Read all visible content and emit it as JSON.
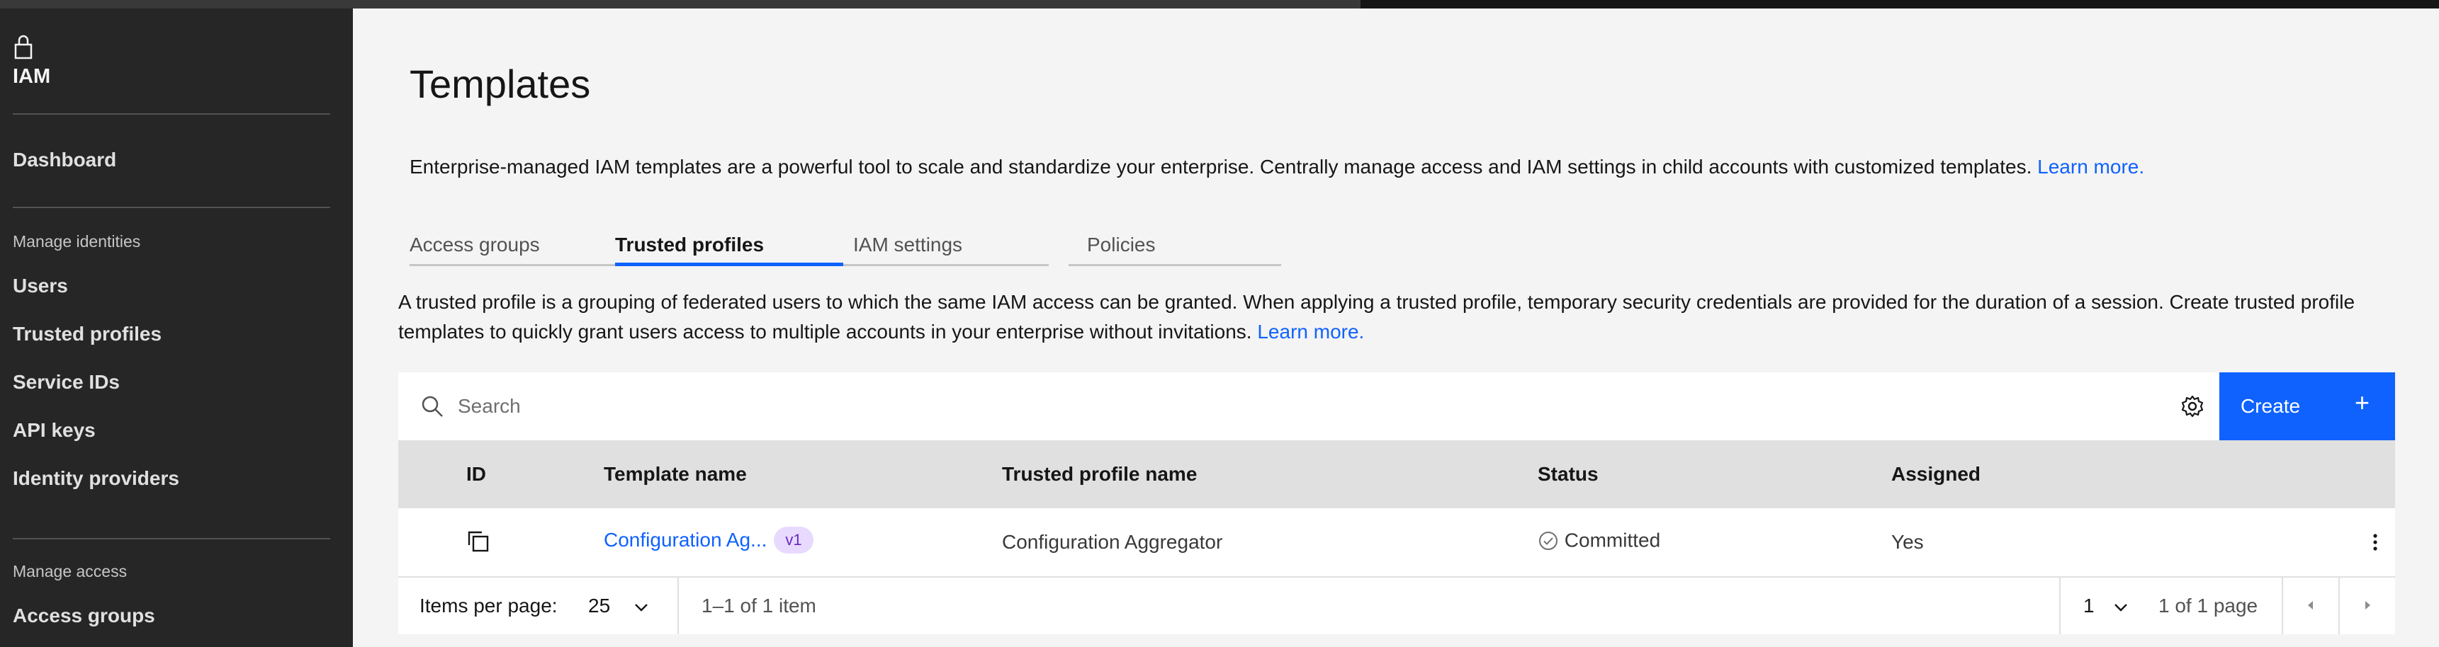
{
  "sidebar": {
    "brand": "IAM",
    "dashboard": "Dashboard",
    "sections": {
      "identities": "Manage identities",
      "access": "Manage access"
    },
    "identities_items": [
      "Users",
      "Trusted profiles",
      "Service IDs",
      "API keys",
      "Identity providers"
    ],
    "access_items": [
      "Access groups"
    ]
  },
  "main": {
    "title": "Templates",
    "intro": "Enterprise-managed IAM templates are a powerful tool to scale and standardize your enterprise. Centrally manage access and IAM settings in child accounts with customized templates.",
    "intro_link": "Learn more.",
    "tabs": [
      "Access groups",
      "Trusted profiles",
      "IAM settings",
      "Policies"
    ],
    "active_tab": "Trusted profiles",
    "tab_desc": "A trusted profile is a grouping of federated users to which the same IAM access can be granted. When applying a trusted profile, temporary security credentials are provided for the duration of a session. Create trusted profile templates to quickly grant users access to multiple accounts in your enterprise without invitations.",
    "tab_desc_link": "Learn more."
  },
  "table": {
    "search_placeholder": "Search",
    "create_label": "Create",
    "headers": [
      "ID",
      "Template name",
      "Trusted profile name",
      "Status",
      "Assigned"
    ],
    "rows": [
      {
        "template_name": "Configuration Ag...",
        "version": "v1",
        "trusted_profile_name": "Configuration Aggregator",
        "status": "Committed",
        "assigned": "Yes"
      }
    ],
    "pagination": {
      "items_per_page_label": "Items per page:",
      "items_per_page": "25",
      "range": "1–1 of 1 item",
      "page": "1",
      "page_of": "1 of 1 page"
    }
  },
  "colors": {
    "accent": "#0f62fe",
    "sidebar_bg": "#262626",
    "tag_bg": "#e8daff",
    "tag_text": "#6929c4"
  }
}
